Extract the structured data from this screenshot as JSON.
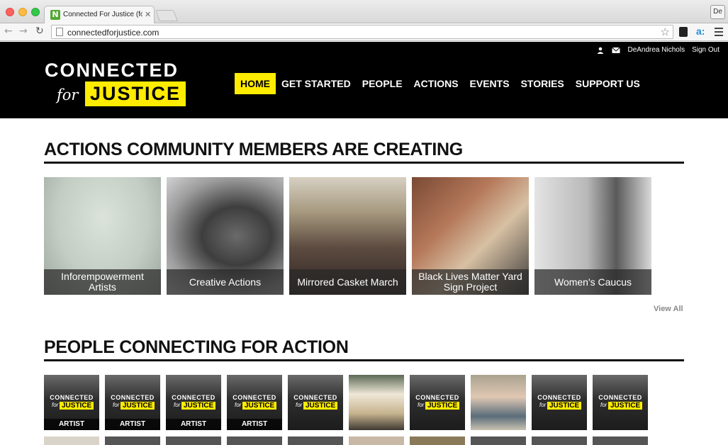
{
  "browser": {
    "tab_title": "Connected For Justice (for",
    "tab_favicon": "N",
    "url": "connectedforjustice.com",
    "profile_label": "De"
  },
  "header": {
    "logo_line1": "CONNECTED",
    "logo_for": "for",
    "logo_justice": "JUSTICE",
    "user_name": "DeAndrea Nichols",
    "sign_out": "Sign Out",
    "nav": [
      "HOME",
      "GET STARTED",
      "PEOPLE",
      "ACTIONS",
      "EVENTS",
      "STORIES",
      "SUPPORT US"
    ],
    "accent": "#ffec00"
  },
  "actions_section": {
    "title": "ACTIONS COMMUNITY MEMBERS ARE CREATING",
    "cards": [
      {
        "label": "Inforempowerment Artists"
      },
      {
        "label": "Creative Actions"
      },
      {
        "label": "Mirrored Casket March"
      },
      {
        "label": "Black Lives Matter Yard Sign Project"
      },
      {
        "label": "Women's Caucus"
      }
    ],
    "view_all": "View All"
  },
  "people_section": {
    "title": "PEOPLE CONNECTING FOR ACTION",
    "people": [
      {
        "role": "ARTIST",
        "type": "logo"
      },
      {
        "role": "ARTIST",
        "type": "logo"
      },
      {
        "role": "ARTIST",
        "type": "logo"
      },
      {
        "role": "ARTIST",
        "type": "logo"
      },
      {
        "role": "",
        "type": "logo"
      },
      {
        "role": "",
        "type": "photo"
      },
      {
        "role": "",
        "type": "logo"
      },
      {
        "role": "",
        "type": "photo"
      },
      {
        "role": "",
        "type": "logo"
      },
      {
        "role": "",
        "type": "logo"
      }
    ],
    "mini_logo_top": "CONNECTED",
    "mini_logo_for": "for",
    "mini_logo_justice": "JUSTICE"
  }
}
